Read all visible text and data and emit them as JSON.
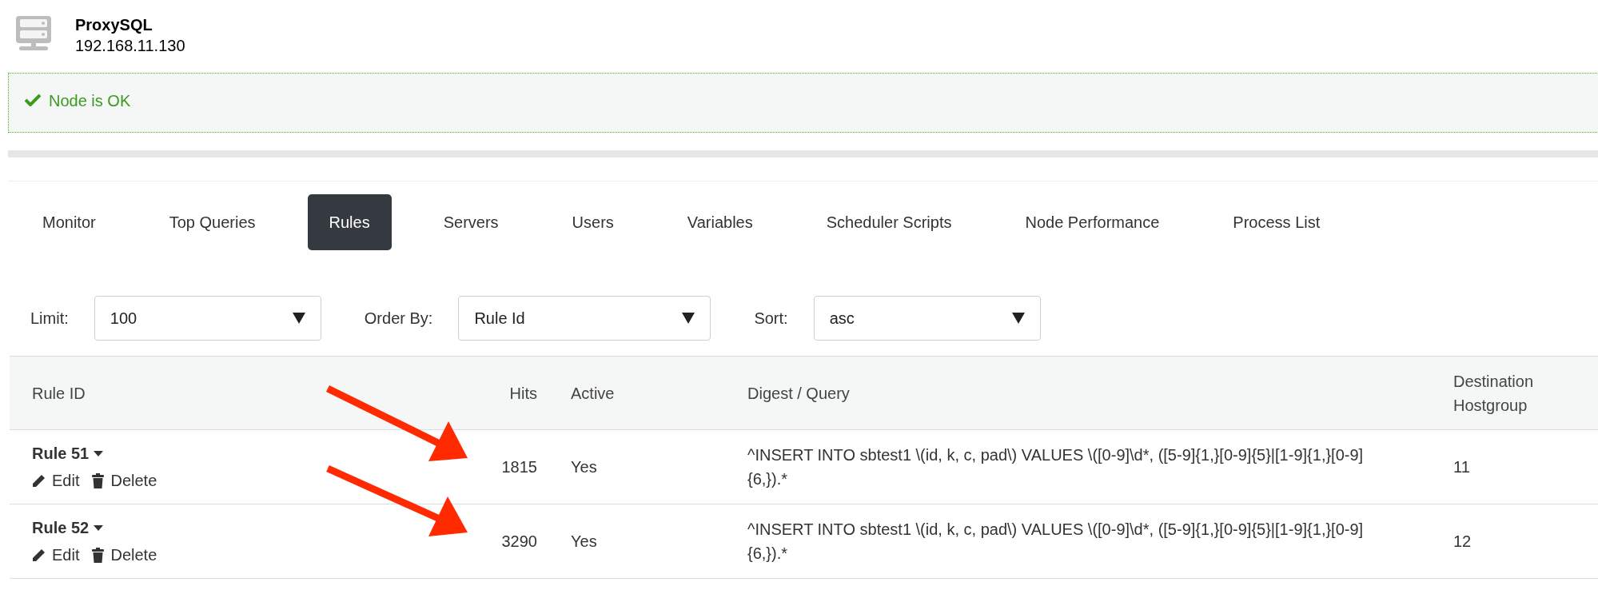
{
  "node": {
    "title": "ProxySQL",
    "address": "192.168.11.130"
  },
  "status": {
    "kind": "ok",
    "message": "Node is OK"
  },
  "tabs": [
    {
      "label": "Monitor",
      "selected": false
    },
    {
      "label": "Top Queries",
      "selected": false
    },
    {
      "label": "Rules",
      "selected": true
    },
    {
      "label": "Servers",
      "selected": false
    },
    {
      "label": "Users",
      "selected": false
    },
    {
      "label": "Variables",
      "selected": false
    },
    {
      "label": "Scheduler Scripts",
      "selected": false
    },
    {
      "label": "Node Performance",
      "selected": false
    },
    {
      "label": "Process List",
      "selected": false
    }
  ],
  "filters": [
    {
      "label": "Limit:",
      "value": "100"
    },
    {
      "label": "Order By:",
      "value": "Rule Id"
    },
    {
      "label": "Sort:",
      "value": "asc"
    }
  ],
  "table": {
    "columns": [
      "Rule ID",
      "Hits",
      "Active",
      "Digest / Query",
      "Destination Hostgroup"
    ],
    "rows": [
      {
        "rule": "Rule 51",
        "actions": [
          "Edit",
          "Delete"
        ],
        "hits": "1815",
        "active": "Yes",
        "query": "^INSERT INTO sbtest1 \\(id, k, c, pad\\) VALUES \\([0-9]\\d*, ([5-9]{1,}[0-9]{5}|[1-9]{1,}[0-9]{6,}).*",
        "hostgroup": "11"
      },
      {
        "rule": "Rule 52",
        "actions": [
          "Edit",
          "Delete"
        ],
        "hits": "3290",
        "active": "Yes",
        "query": "^INSERT INTO sbtest1 \\(id, k, c, pad\\) VALUES \\([0-9]\\d*, ([5-9]{1,}[0-9]{5}|[1-9]{1,}[0-9]{6,}).*",
        "hostgroup": "12"
      }
    ]
  }
}
